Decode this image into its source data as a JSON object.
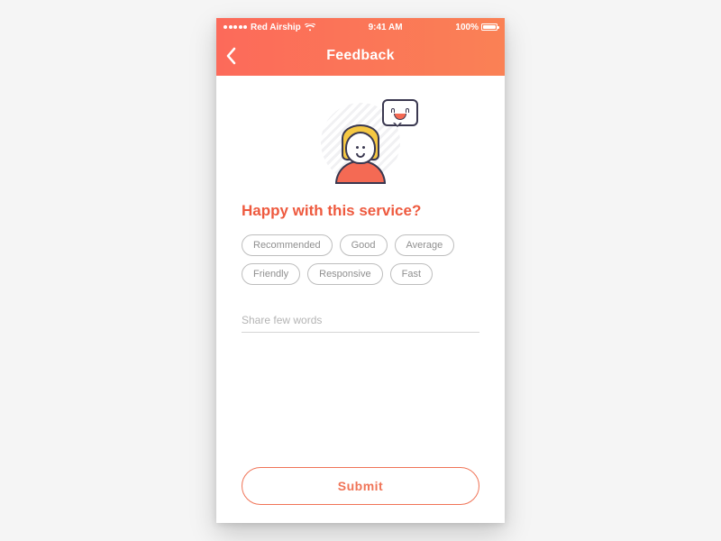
{
  "status": {
    "carrier": "Red Airship",
    "time": "9:41 AM",
    "battery_pct": "100%"
  },
  "nav": {
    "title": "Feedback"
  },
  "main": {
    "question": "Happy with this service?",
    "chips": [
      {
        "label": "Recommended"
      },
      {
        "label": "Good"
      },
      {
        "label": "Average"
      },
      {
        "label": "Friendly"
      },
      {
        "label": "Responsive"
      },
      {
        "label": "Fast"
      }
    ],
    "input_placeholder": "Share few words",
    "submit_label": "Submit"
  },
  "colors": {
    "accent": "#f07457",
    "brand_orange": "#ee5a3f"
  }
}
